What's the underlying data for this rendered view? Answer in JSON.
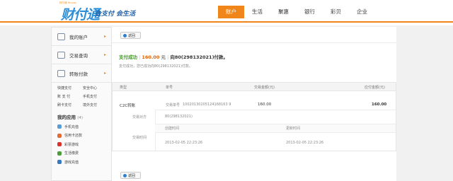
{
  "header": {
    "logo_small": "财付通 Tenpay",
    "logo_main": "财付通",
    "slogan": "会支付 会生活",
    "nav": [
      "账户",
      "生活",
      "聚惠",
      "银行",
      "彩贝",
      "企业"
    ],
    "active_nav": "账户"
  },
  "sidebar": {
    "items": [
      {
        "label": "我的账户",
        "icon": "user-icon"
      },
      {
        "label": "交易查询",
        "icon": "search-icon"
      },
      {
        "label": "转账付款",
        "icon": "card-icon"
      }
    ],
    "links": [
      "快捷支付",
      "安全中心",
      "账 支 付",
      "手机支付",
      "刷卡支付",
      "境外支付"
    ],
    "apps_title": "我的应用",
    "apps_count": "(4)",
    "apps": [
      {
        "label": "手机充值",
        "color": "#5b9bd5"
      },
      {
        "label": "信用卡还款",
        "color": "#e46c3a"
      },
      {
        "label": "彩票游戏",
        "color": "#d9342b"
      },
      {
        "label": "生活缴费",
        "color": "#4a9f3a"
      },
      {
        "label": "游戏充值",
        "color": "#3b78c2"
      }
    ]
  },
  "main": {
    "back_label": "返回",
    "status": {
      "ok": "支付成功",
      "amount": "160.00",
      "unit": "元",
      "recipient": "向80(298132021)付款。"
    },
    "sub_status": "支付成功，您已成功向80(298132021)付款。",
    "table": {
      "headers": [
        "类型",
        "单号",
        "交易金额(元)",
        "应付金额(元)"
      ],
      "row": {
        "type": "C2C转账",
        "order_label": "交易单号",
        "order_no": "10020130205124168163 9",
        "amount": "160.00",
        "payable": "160.00"
      },
      "counterparty_label": "交易对方",
      "counterparty": "80(298132021)",
      "time_label": "交易时间",
      "created_label": "创建时间",
      "updated_label": "更新时间",
      "created": "2013-02-05 22:23:26",
      "updated": "2013-02-05 22:23:26"
    }
  },
  "colors": {
    "accent": "#f08519",
    "success": "#3a9c1e",
    "amount": "#e06000"
  }
}
